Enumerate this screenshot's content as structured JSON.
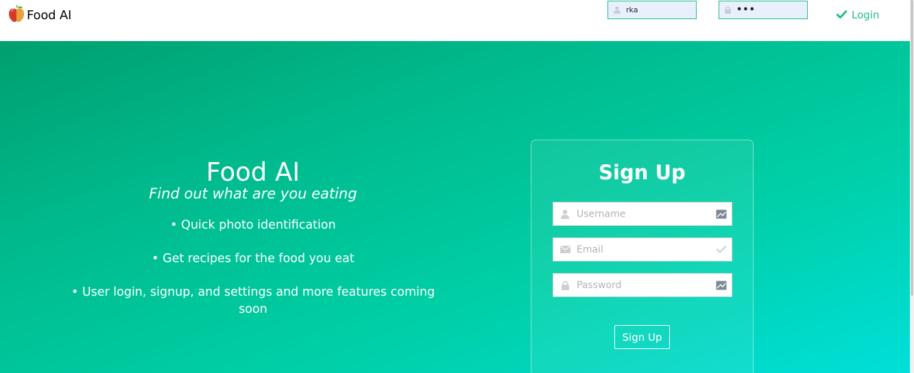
{
  "navbar": {
    "brand_name": "Food AI",
    "brand_icon": "apple-icon",
    "username_value": "rka",
    "password_value": "•••",
    "login_label": "Login",
    "accent_color": "#1fbf86"
  },
  "hero": {
    "title": "Food AI",
    "tagline": "Find out what are you eating",
    "features": [
      "• Quick photo identification",
      "• Get recipes for the food you eat",
      "• User login, signup, and settings and more features coming soon"
    ]
  },
  "signup": {
    "title": "Sign Up",
    "username_placeholder": "Username",
    "email_placeholder": "Email",
    "password_placeholder": "Password",
    "button_label": "Sign Up"
  }
}
